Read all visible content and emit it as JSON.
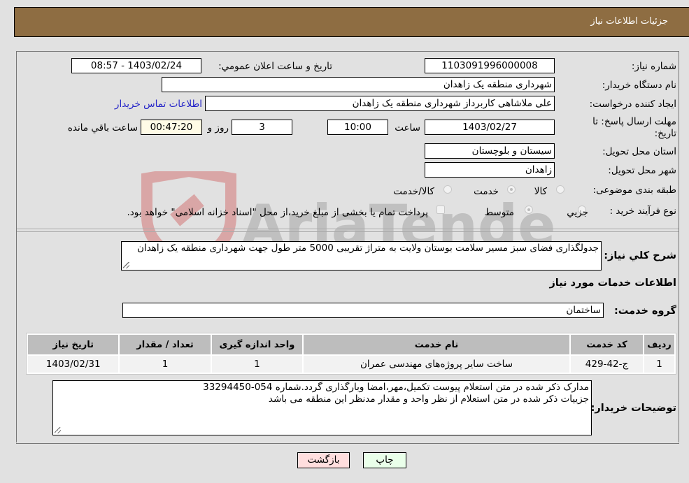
{
  "header": {
    "title": "جزئیات اطلاعات نیاز"
  },
  "form": {
    "need_number": {
      "label": "شماره نیاز:",
      "value": "1103091996000008"
    },
    "announce_datetime": {
      "label": "تاریخ و ساعت اعلان عمومي:",
      "value": "1403/02/24 - 08:57"
    },
    "buyer_org": {
      "label": "نام دستگاه خريدار:",
      "value": "شهرداری منطقه یک زاهدان"
    },
    "requester": {
      "label": "ایجاد کننده درخواست:",
      "value": "علی ملاشاهی کاربرداز شهرداری منطقه یک زاهدان",
      "contact_link": "اطلاعات تماس خريدار"
    },
    "deadline": {
      "label_line1": "مهلت ارسال پاسخ: تا",
      "label_line2": "تاریخ:",
      "date": "1403/02/27",
      "time_label": "ساعت",
      "time": "10:00",
      "days": "3",
      "days_label": "روز و",
      "remaining": "00:47:20",
      "remaining_label": "ساعت باقي مانده"
    },
    "province": {
      "label": "استان محل تحویل:",
      "value": "سیستان و بلوچستان"
    },
    "city": {
      "label": "شهر محل تحویل:",
      "value": "زاهدان"
    },
    "category": {
      "label": "طبقه بندی موضوعی:",
      "options": [
        {
          "label": "کالا",
          "checked": false
        },
        {
          "label": "خدمت",
          "checked": true
        },
        {
          "label": "کالا/خدمت",
          "checked": false
        }
      ]
    },
    "purchase_type": {
      "label": "نوع فرآیند خرید :",
      "options": [
        {
          "label": "جزيي",
          "checked": false
        },
        {
          "label": "متوسط",
          "checked": true
        }
      ],
      "treasury_note": "پرداخت تمام یا بخشی از مبلغ خرید،از محل \"اسناد خزانه اسلامی\" خواهد بود.",
      "treasury_checked": false
    },
    "description": {
      "label": "شرح کلي نیاز:",
      "value": "جدولگذاری فضای سبز مسیر سلامت بوستان ولایت به متراژ تقریبی 5000 متر طول جهت شهرداری منطقه یک زاهدان"
    },
    "services_title": "اطلاعات خدمات مورد نیاز",
    "service_group": {
      "label": "گروه خدمت:",
      "value": "ساختمان"
    }
  },
  "table": {
    "headers": [
      "ردیف",
      "کد خدمت",
      "نام خدمت",
      "واحد اندازه گیری",
      "تعداد / مقدار",
      "تاریخ نیاز"
    ],
    "rows": [
      [
        "1",
        "ج-42-429",
        "ساخت سایر پروژه‌های مهندسی عمران",
        "1",
        "1",
        "1403/02/31"
      ]
    ]
  },
  "buyer_notes": {
    "label": "توضیحات خریدار:",
    "line1": "مدارک ذکر شده در متن استعلام پیوست تکمیل،مهر،امضا وبارگذاری گردد.شماره 054-33294450",
    "line2": "جزییات ذکر شده در متن استعلام از نظر واحد و مقدار مدنظر این منطقه می باشد"
  },
  "buttons": {
    "print": "چاپ",
    "back": "بازگشت"
  },
  "watermark": {
    "text": "AriaTender.neT"
  },
  "colors": {
    "header_bg": "#8e6d42",
    "print_bg": "#eaffea",
    "back_bg": "#ffdede",
    "link": "#2424c8"
  }
}
